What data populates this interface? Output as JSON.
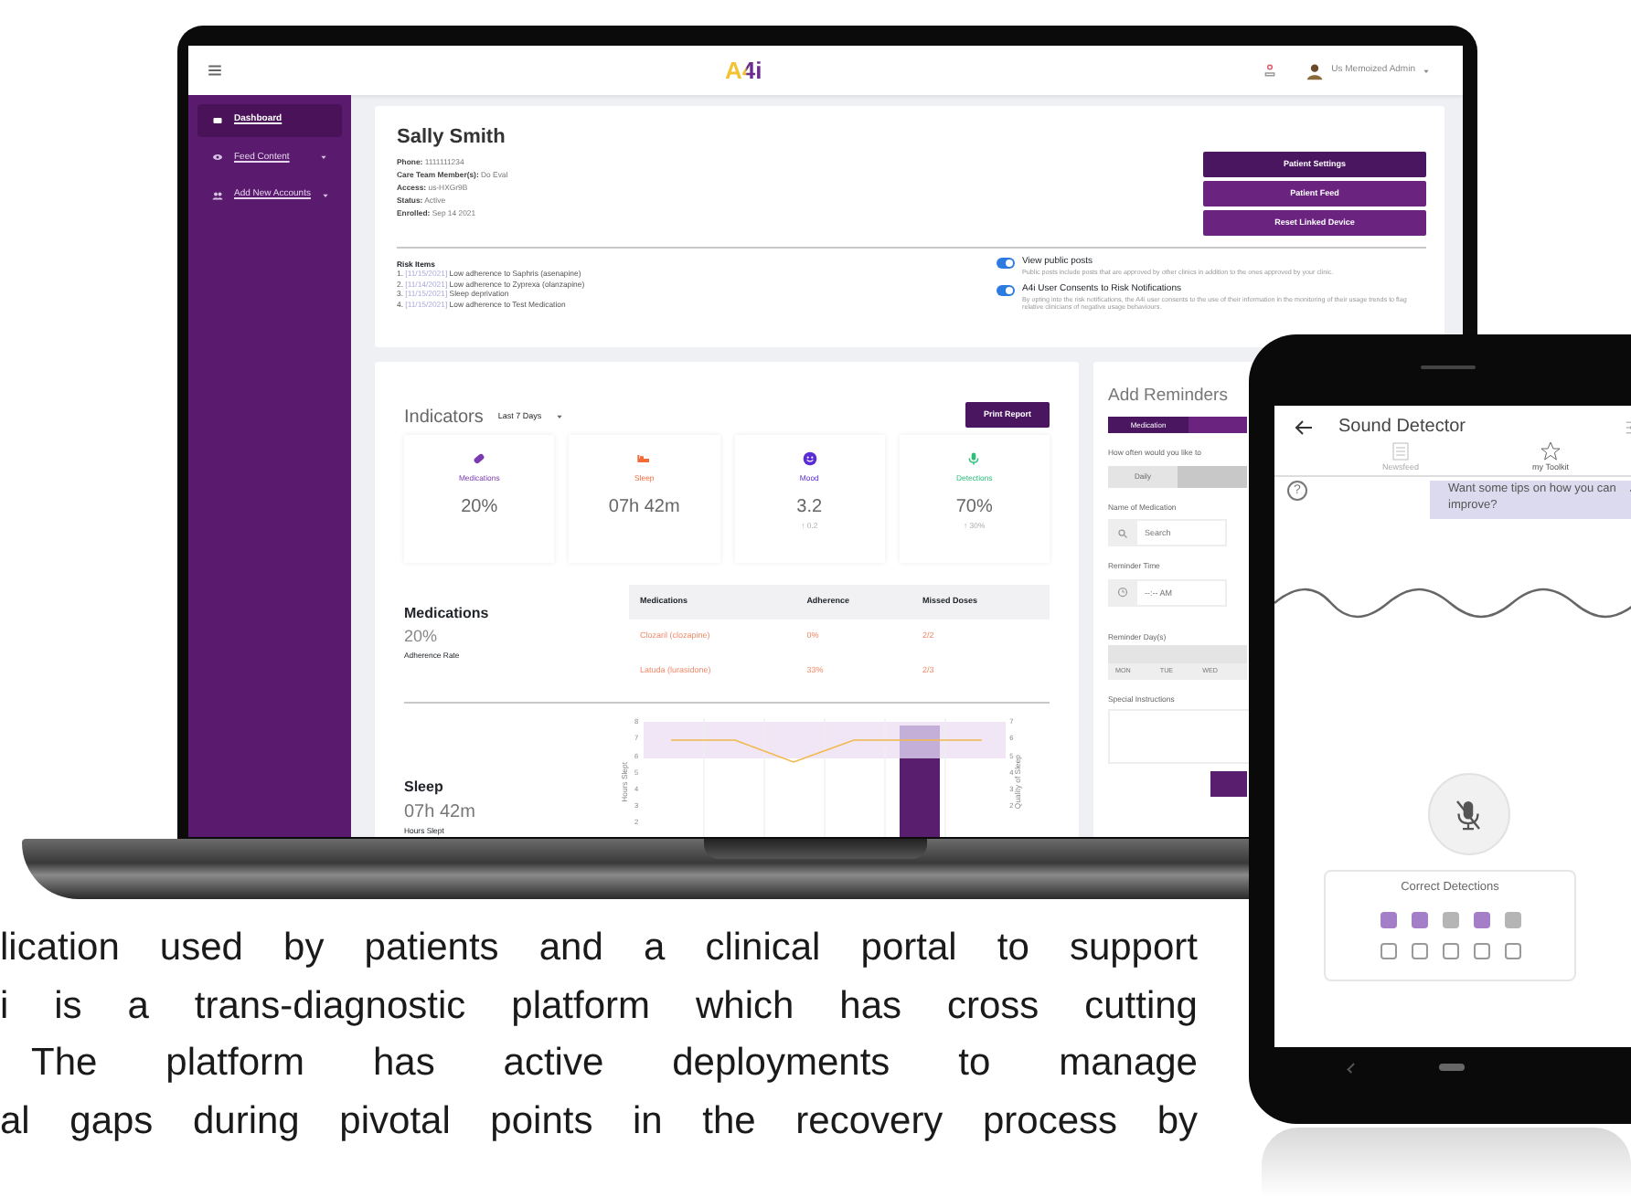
{
  "laptop": {
    "topbar": {
      "logo": "A4i",
      "user": "Us Memoized Admin"
    },
    "sidebar": {
      "items": [
        {
          "label": "Dashboard",
          "selected": true,
          "expandable": false
        },
        {
          "label": "Feed Content",
          "selected": false,
          "expandable": true
        },
        {
          "label": "Add New Accounts",
          "selected": false,
          "expandable": true
        }
      ]
    },
    "patient": {
      "name": "Sally Smith",
      "details": [
        {
          "label": "Phone:",
          "value": "1111111234"
        },
        {
          "label": "Care Team Member(s):",
          "value": "Do Eval"
        },
        {
          "label": "Access:",
          "value": "us-HXGr9B"
        },
        {
          "label": "Status:",
          "value": "Active"
        },
        {
          "label": "Enrolled:",
          "value": "Sep 14 2021"
        }
      ],
      "buttons": [
        {
          "label": "Patient Settings",
          "kind": "dark"
        },
        {
          "label": "Patient Feed",
          "kind": "normal"
        },
        {
          "label": "Reset Linked Device",
          "kind": "normal"
        }
      ],
      "risk_title": "Risk Items",
      "risk_items": [
        {
          "number": "1.",
          "date": "[11/15/2021]",
          "text": "Low adherence to Saphris (asenapine)"
        },
        {
          "number": "2.",
          "date": "[11/14/2021]",
          "text": "Low adherence to Zyprexa (olanzapine)"
        },
        {
          "number": "3.",
          "date": "[11/15/2021]",
          "text": "Sleep deprivation"
        },
        {
          "number": "4.",
          "date": "[11/15/2021]",
          "text": "Low adherence to Test Medication"
        }
      ],
      "toggles": [
        {
          "label": "View public posts",
          "description": "Public posts include posts that are approved by other clinics in addition to the ones approved by your clinic.",
          "on": true
        },
        {
          "label": "A4i User Consents to Risk Notifications",
          "description": "By opting into the risk notifications, the A4i user consents to the use of their information in the monitoring of their usage trends to flag relative clinicians of negative usage behaviours.",
          "on": true
        }
      ]
    },
    "indicators": {
      "title": "Indicators",
      "range": "Last 7 Days",
      "print_button": "Print Report",
      "tiles": [
        {
          "kind": "pill",
          "label": "Medications",
          "value": "20%",
          "color": "#7a3bb0"
        },
        {
          "kind": "bed",
          "label": "Sleep",
          "value": "07h 42m",
          "color": "#f26b3a"
        },
        {
          "kind": "face",
          "label": "Mood",
          "value": "3.2",
          "change": "↑ 0.2",
          "color": "#5b2bd6"
        },
        {
          "kind": "mic",
          "label": "Detections",
          "value": "70%",
          "change": "↑ 30%",
          "color": "#2bbf7a"
        }
      ],
      "medications": {
        "title": "Medications",
        "value": "20%",
        "caption": "Adherence Rate",
        "columns": [
          "Medications",
          "Adherence",
          "Missed Doses"
        ],
        "rows": [
          [
            "Clozaril (clozapine)",
            "0%",
            "2/2"
          ],
          [
            "Latuda (lurasidone)",
            "33%",
            "2/3"
          ]
        ]
      },
      "sleep": {
        "title": "Sleep",
        "value": "07h 42m",
        "caption": "Hours Slept",
        "left_axis": "Hours Slept",
        "right_axis": "Quality of Sleep",
        "left_ticks": [
          "8",
          "7",
          "6",
          "5",
          "4",
          "3",
          "2"
        ],
        "right_ticks": [
          "7",
          "6",
          "5",
          "4",
          "3",
          "2"
        ]
      }
    },
    "reminders": {
      "title": "Add Reminders",
      "tabs": [
        {
          "label": "Medication",
          "selected": true
        },
        {
          "selected": false
        }
      ],
      "frequency_label": "How often would you like to",
      "frequency": [
        {
          "label": "Daily",
          "selected": false
        },
        {
          "selected": true
        }
      ],
      "name_label": "Name of Medication",
      "name_placeholder": "Search",
      "time_label": "Reminder Time",
      "time_placeholder": "--:-- AM",
      "days_label": "Reminder Day(s)",
      "days": [
        "MON",
        "TUE",
        "WED"
      ],
      "instructions_label": "Special Instructions"
    }
  },
  "phone": {
    "title": "Sound Detector",
    "tabs": [
      {
        "label": "Newsfeed",
        "selected": false
      },
      {
        "label": "my Toolkit",
        "selected": true
      }
    ],
    "help": "?",
    "tip": "Want some tips on how you can improve?",
    "mic_muted": true,
    "detections_title": "Correct Detections",
    "detections": [
      {
        "correct": true
      },
      {
        "correct": true
      },
      {
        "correct": false
      },
      {
        "correct": true
      },
      {
        "correct": false
      }
    ],
    "attempts": [
      {
        "filled": false
      },
      {
        "filled": false
      },
      {
        "filled": false
      },
      {
        "filled": false
      },
      {
        "filled": false
      }
    ]
  },
  "description_lines": [
    "lication used by patients and a clinical portal to support",
    "i is a trans-diagnostic platform which has cross cutting",
    "The platform has active deployments to manage",
    "al gaps during pivotal points in the recovery process by"
  ]
}
